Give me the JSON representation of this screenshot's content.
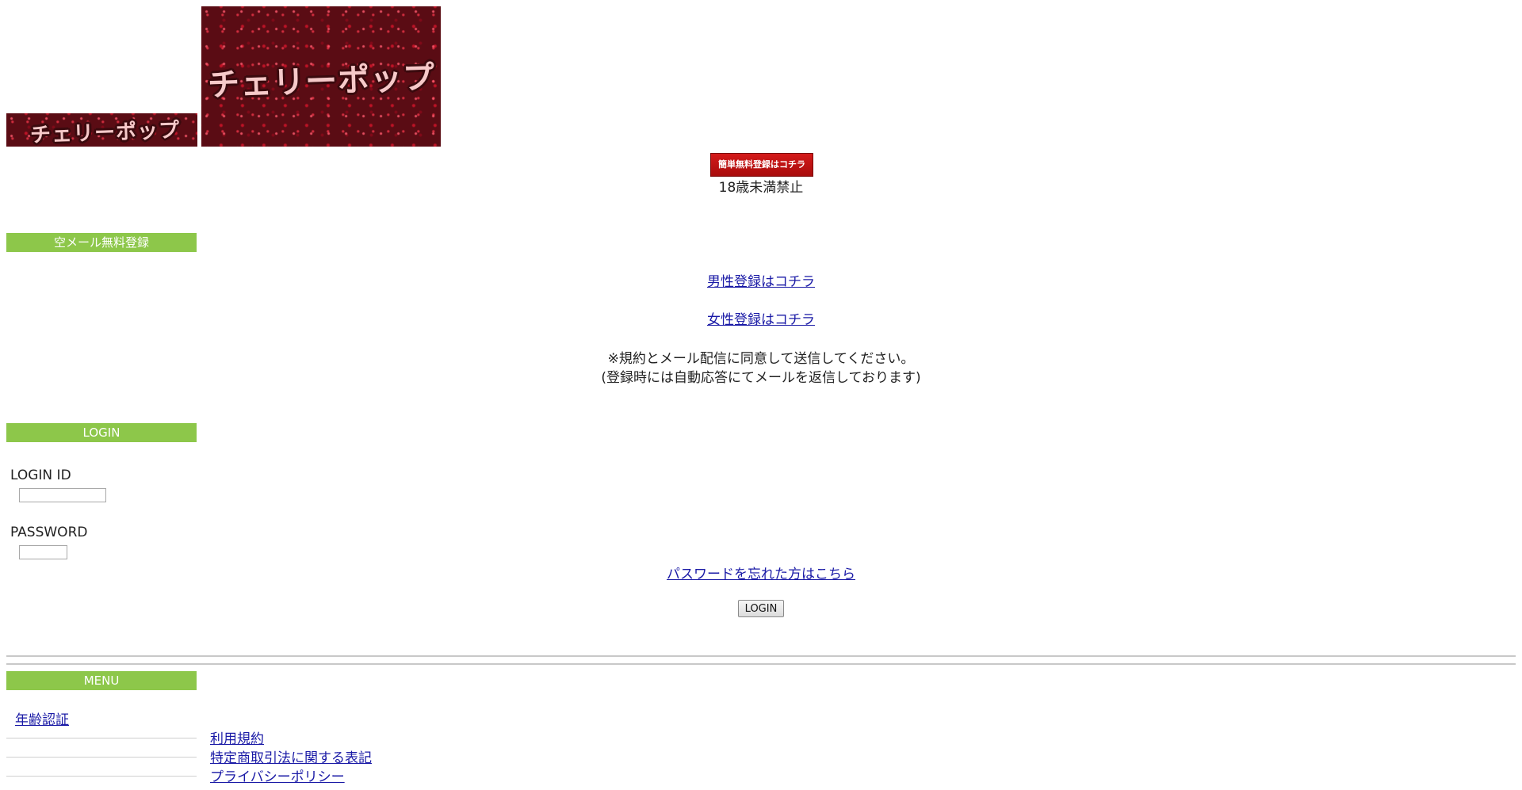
{
  "header": {
    "logo_small_text": "チェリーポップ",
    "logo_large_text": "チェリーポップ",
    "register_button_label": "簡単無料登録はコチラ",
    "age_notice": "18歳未満禁止"
  },
  "register": {
    "section_title": "空メール無料登録",
    "male_link": "男性登録はコチラ",
    "female_link": "女性登録はコチラ",
    "notice_line1": "※規約とメール配信に同意して送信してください。",
    "notice_line2": "(登録時には自動応答にてメールを返信しております)"
  },
  "login": {
    "section_title": "LOGIN",
    "id_label": "LOGIN ID",
    "id_value": "",
    "password_label": "PASSWORD",
    "password_value": "",
    "forgot_link": "パスワードを忘れた方はこちら",
    "submit_label": "LOGIN"
  },
  "menu": {
    "section_title": "MENU",
    "items": [
      {
        "label": "年齢認証"
      },
      {
        "label": "利用規約"
      },
      {
        "label": "特定商取引法に関する表記"
      },
      {
        "label": "プライバシーポリシー"
      }
    ]
  },
  "colors": {
    "accent_green": "#8dc74a",
    "link_blue": "#1a1aa6",
    "register_red": "#c41414"
  }
}
